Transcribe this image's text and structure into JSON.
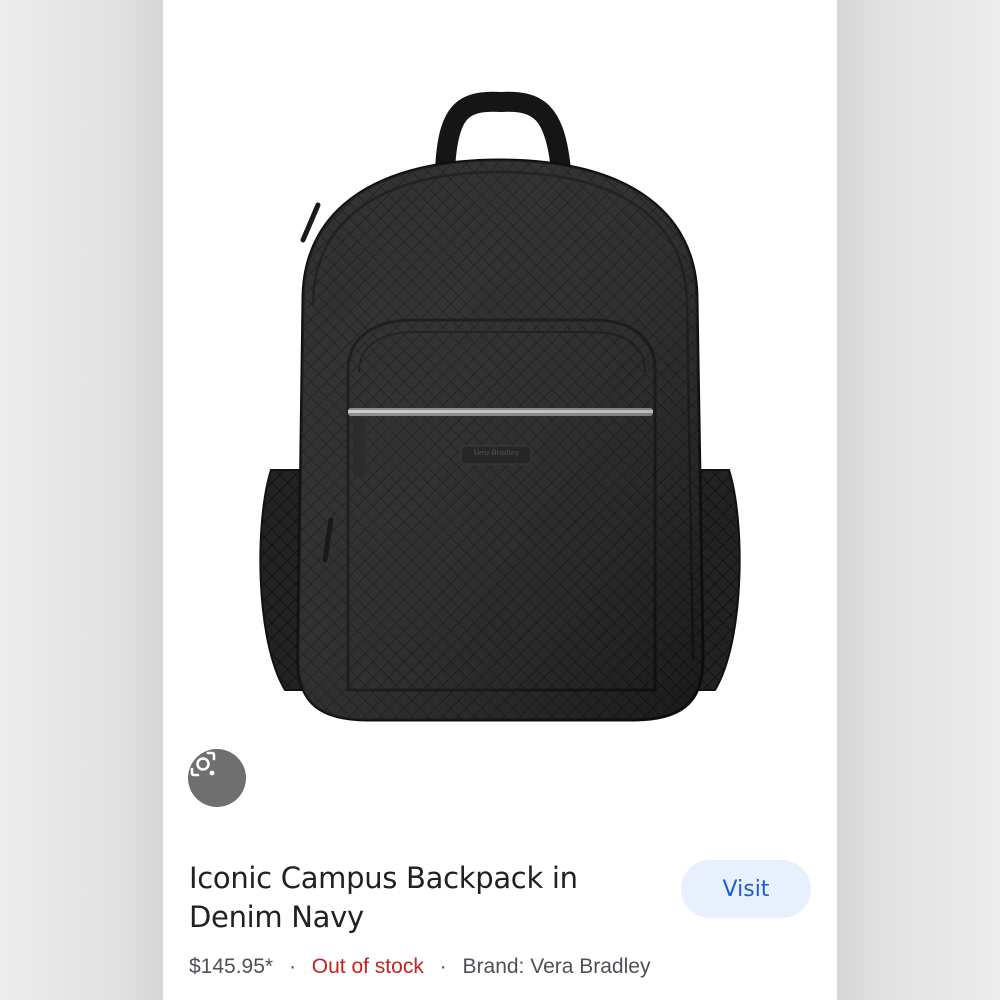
{
  "product": {
    "title": "Iconic Campus Backpack in Denim Navy",
    "price": "$145.95*",
    "stock_status": "Out of stock",
    "brand": "Brand: Vera Bradley",
    "separator": "·",
    "logo_patch_text": "Vera Bradley"
  },
  "actions": {
    "visit_label": "Visit",
    "lens_icon": "lens-search-icon"
  },
  "colors": {
    "visit_bg": "#e8f0fe",
    "visit_text": "#1a5fd0",
    "out_of_stock": "#c5221f",
    "backpack": "#1e1e1e"
  }
}
